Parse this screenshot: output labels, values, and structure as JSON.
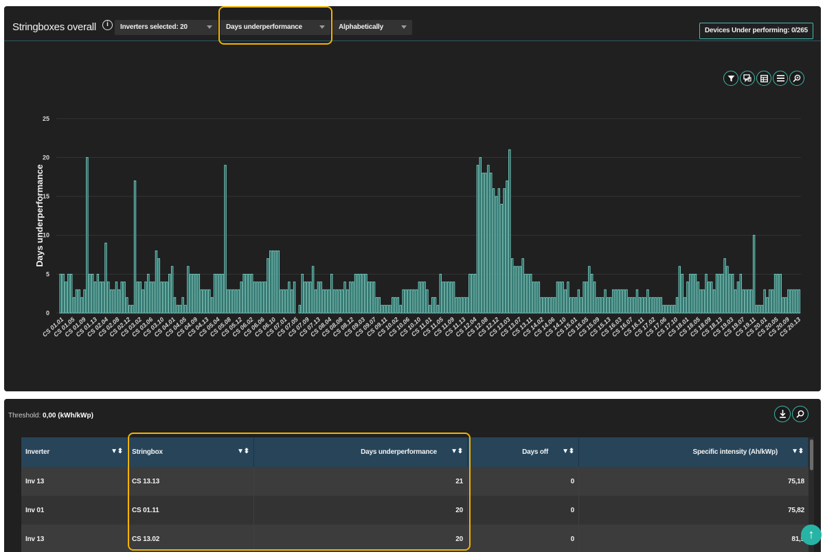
{
  "header": {
    "title": "Stringboxes overall",
    "info_icon": "info-circle-icon",
    "inverters_dropdown": "Inverters selected: 20",
    "metric_dropdown": "Days underperformance",
    "sort_dropdown": "Alphabetically",
    "devices_button": "Devices Under performing: 0/265"
  },
  "toolbar_icons": [
    "filter-icon",
    "comment-icon",
    "table-icon",
    "menu-icon",
    "zoom-icon"
  ],
  "colors": {
    "bar_fill": "#1e5a56",
    "bar_stroke": "#7fd8cb",
    "highlight": "#f4b400",
    "accent": "#27b4a5",
    "table_header": "#274459"
  },
  "chart_data": {
    "type": "bar",
    "ylabel": "Days underperformance",
    "xlabel": "",
    "ylim": [
      0,
      27
    ],
    "yticks": [
      0,
      5,
      10,
      15,
      20,
      25
    ],
    "grid": true,
    "tick_labels": [
      "CS 01.01",
      "CS 01.05",
      "CS 01.09",
      "CS 01.13",
      "CS 02.04",
      "CS 02.08",
      "CS 02.12",
      "CS 03.02",
      "CS 03.06",
      "CS 03.10",
      "CS 04.01",
      "CS 04.05",
      "CS 04.09",
      "CS 04.13",
      "CS 05.04",
      "CS 05.08",
      "CS 05.12",
      "CS 06.02",
      "CS 06.06",
      "CS 06.10",
      "CS 07.01",
      "CS 07.05",
      "CS 07.09",
      "CS 07.13",
      "CS 08.04",
      "CS 08.08",
      "CS 08.12",
      "CS 09.03",
      "CS 09.07",
      "CS 09.11",
      "CS 10.02",
      "CS 10.06",
      "CS 10.10",
      "CS 11.01",
      "CS 11.05",
      "CS 11.09",
      "CS 11.13",
      "CS 12.04",
      "CS 12.08",
      "CS 12.12",
      "CS 13.03",
      "CS 13.07",
      "CS 13.11",
      "CS 14.02",
      "CS 14.06",
      "CS 14.10",
      "CS 15.01",
      "CS 15.05",
      "CS 15.09",
      "CS 15.13",
      "CS 16.03",
      "CS 16.07",
      "CS 16.11",
      "CS 17.02",
      "CS 17.06",
      "CS 17.10",
      "CS 18.01",
      "CS 18.05",
      "CS 18.09",
      "CS 18.13",
      "CS 19.03",
      "CS 19.07",
      "CS 19.11",
      "CS 20.01",
      "CS 20.05",
      "CS 20.09",
      "CS 20.13"
    ],
    "values": [
      5,
      5,
      4,
      5,
      5,
      2,
      3,
      3,
      2,
      3,
      20,
      5,
      5,
      4,
      5,
      4,
      4,
      9,
      4,
      3,
      3,
      4,
      3,
      4,
      4,
      2,
      1,
      1,
      17,
      4,
      4,
      3,
      4,
      5,
      4,
      4,
      8,
      7,
      4,
      4,
      4,
      5,
      6,
      2,
      1,
      1,
      2,
      1,
      6,
      5,
      5,
      5,
      5,
      3,
      3,
      3,
      3,
      2,
      5,
      5,
      5,
      5,
      19,
      3,
      3,
      3,
      3,
      3,
      4,
      5,
      5,
      5,
      5,
      4,
      4,
      4,
      4,
      4,
      7,
      8,
      8,
      8,
      8,
      3,
      3,
      3,
      4,
      3,
      4,
      0,
      1,
      5,
      4,
      4,
      4,
      6,
      3,
      4,
      4,
      3,
      3,
      3,
      5,
      3,
      3,
      3,
      3,
      4,
      3,
      4,
      4,
      5,
      5,
      5,
      5,
      5,
      4,
      4,
      4,
      2,
      2,
      1,
      1,
      1,
      1,
      2,
      2,
      2,
      1,
      3,
      3,
      3,
      3,
      3,
      3,
      4,
      4,
      4,
      3,
      1,
      2,
      2,
      1,
      5,
      4,
      4,
      4,
      4,
      4,
      2,
      2,
      2,
      2,
      2,
      5,
      5,
      5,
      19,
      20,
      18,
      18,
      19,
      18,
      16,
      15,
      16,
      14,
      16,
      17,
      21,
      7,
      6,
      6,
      6,
      7,
      5,
      5,
      5,
      4,
      4,
      4,
      2,
      2,
      2,
      2,
      2,
      2,
      4,
      4,
      4,
      3,
      4,
      2,
      2,
      2,
      3,
      2,
      4,
      4,
      6,
      5,
      4,
      2,
      2,
      2,
      3,
      2,
      2,
      3,
      3,
      3,
      3,
      3,
      3,
      2,
      2,
      2,
      3,
      2,
      2,
      2,
      3,
      2,
      2,
      2,
      2,
      2,
      1,
      1,
      1,
      1,
      1,
      2,
      6,
      5,
      2,
      4,
      5,
      5,
      5,
      4,
      3,
      3,
      5,
      4,
      4,
      3,
      5,
      5,
      5,
      7,
      6,
      5,
      5,
      3,
      4,
      5,
      3,
      3,
      3,
      3,
      10,
      1,
      1,
      1,
      3,
      2,
      3,
      3,
      5,
      5,
      5,
      2,
      2,
      3,
      3,
      3,
      3,
      3
    ]
  },
  "table": {
    "threshold_label": "Threshold:",
    "threshold_value": "0,00 (kWh/kWp)",
    "columns": [
      "Inverter",
      "Stringbox",
      "Days underperformance",
      "Days off",
      "Specific intensity (Ah/kWp)"
    ],
    "rows": [
      [
        "Inv 13",
        "CS 13.13",
        "21",
        "0",
        "75,18"
      ],
      [
        "Inv 01",
        "CS 01.11",
        "20",
        "0",
        "75,82"
      ],
      [
        "Inv 13",
        "CS 13.02",
        "20",
        "0",
        "81,5"
      ]
    ]
  }
}
